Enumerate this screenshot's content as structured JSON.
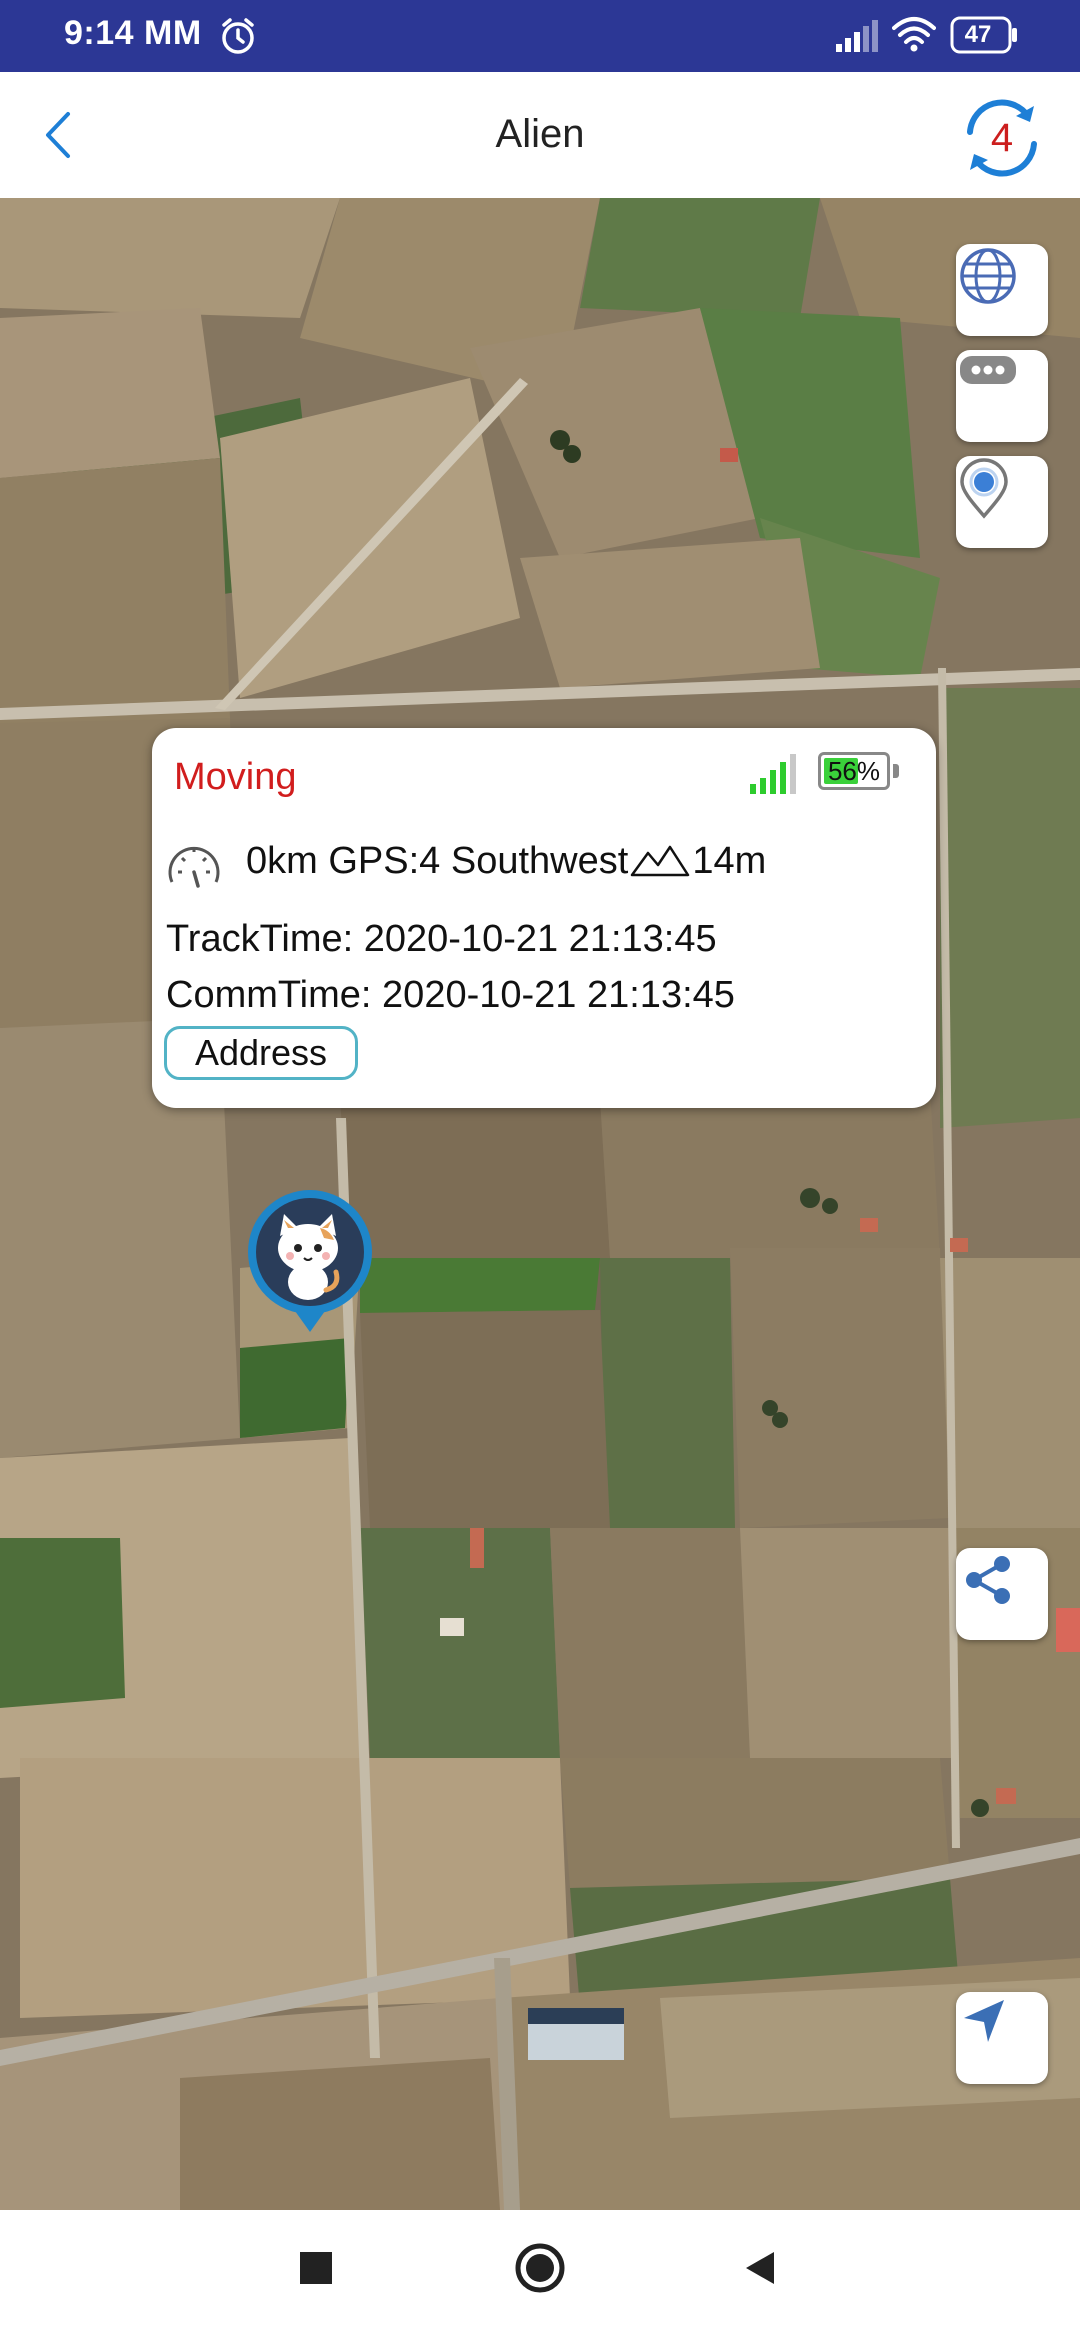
{
  "status_bar": {
    "time": "9:14 MM",
    "battery": "47",
    "icons": [
      "alarm-icon",
      "signal-icon",
      "wifi-icon",
      "battery-icon"
    ]
  },
  "header": {
    "title": "Alien",
    "refresh_count": "4",
    "back_icon": "chevron-left-icon",
    "refresh_icon": "refresh-icon"
  },
  "map_controls": {
    "layers_icon": "globe-icon",
    "more_icon": "more-icon",
    "locate_icon": "location-pin-icon",
    "share_icon": "share-icon",
    "navigate_icon": "navigation-arrow-icon"
  },
  "popup": {
    "status": "Moving",
    "battery": "56%",
    "battery_level": 0.56,
    "speed": "0km",
    "gps": "GPS:4",
    "direction": "Southwest",
    "altitude": "14m",
    "track_time_label": "TrackTime:",
    "track_time": "2020-10-21 21:13:45",
    "comm_time_label": "CommTime:",
    "comm_time": "2020-10-21 21:13:45",
    "address_button": "Address"
  },
  "colors": {
    "status_bar": "#2c3795",
    "accent": "#1e7fd6",
    "status_moving": "#d11d1d",
    "signal_green": "#2ecc2e",
    "address_border": "#52b3c6"
  }
}
